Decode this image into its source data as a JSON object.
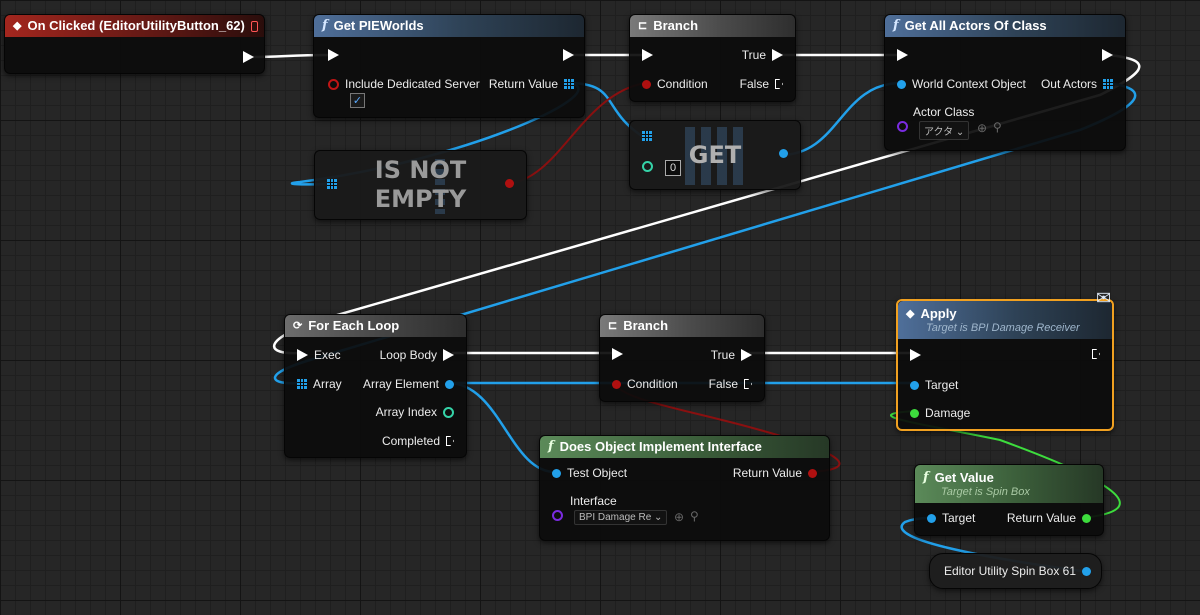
{
  "nodes": {
    "on_clicked": {
      "title": "On Clicked (EditorUtilityButton_62)"
    },
    "get_pie_worlds": {
      "title": "Get PIEWorlds",
      "pin_include": "Include Dedicated Server",
      "pin_return": "Return Value",
      "include_checked": true
    },
    "branch_top": {
      "title": "Branch",
      "pin_condition": "Condition",
      "pin_true": "True",
      "pin_false": "False"
    },
    "get_all_actors": {
      "title": "Get All Actors Of Class",
      "pin_world": "World Context Object",
      "pin_out": "Out Actors",
      "pin_actor_class": "Actor Class",
      "actor_class_value": "アクタ"
    },
    "is_not_empty": {
      "line1": "IS NOT",
      "line2": "EMPTY"
    },
    "get": {
      "label": "GET",
      "index_value": "0"
    },
    "for_each": {
      "title": "For Each Loop",
      "pin_exec": "Exec",
      "pin_array": "Array",
      "pin_loop_body": "Loop Body",
      "pin_array_element": "Array Element",
      "pin_array_index": "Array Index",
      "pin_completed": "Completed"
    },
    "branch_bottom": {
      "title": "Branch",
      "pin_condition": "Condition",
      "pin_true": "True",
      "pin_false": "False"
    },
    "apply": {
      "title": "Apply",
      "subtitle": "Target is BPI Damage Receiver",
      "pin_target": "Target",
      "pin_damage": "Damage"
    },
    "does_implement": {
      "title": "Does Object Implement Interface",
      "pin_test": "Test Object",
      "pin_return": "Return Value",
      "pin_interface": "Interface",
      "interface_value": "BPI Damage Re"
    },
    "get_value": {
      "title": "Get Value",
      "subtitle": "Target is Spin Box",
      "pin_target": "Target",
      "pin_return": "Return Value"
    },
    "spin_box_ref": {
      "label": "Editor Utility Spin Box 61"
    }
  },
  "colors": {
    "exec_wire": "#ffffff",
    "object_wire": "#22a0ea",
    "bool_wire": "#8a1010",
    "float_wire": "#3ddc3d",
    "selected_border": "#f0a020"
  }
}
